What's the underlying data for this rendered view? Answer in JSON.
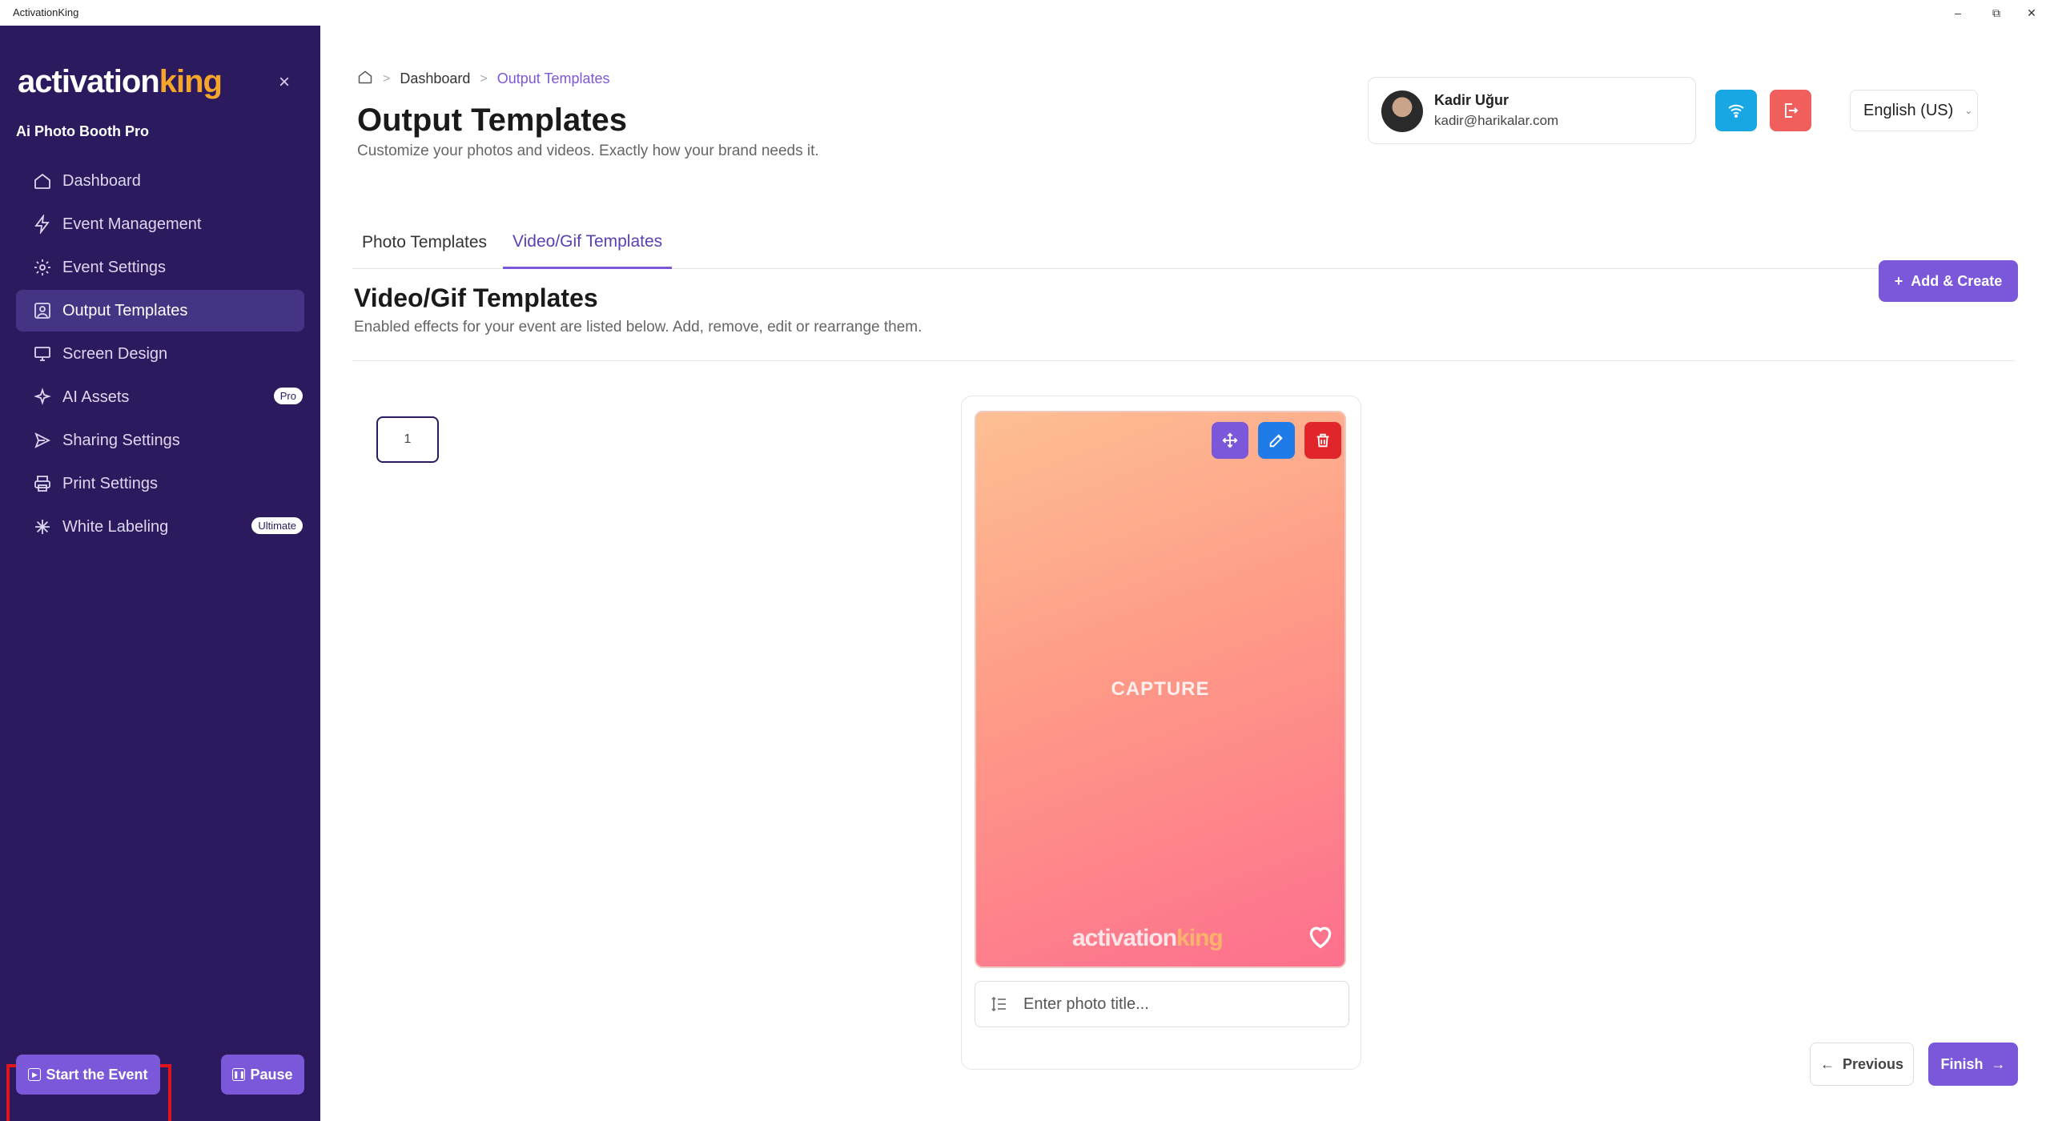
{
  "window": {
    "title": "ActivationKing",
    "minimize": "–",
    "restore": "⧉",
    "close": "✕"
  },
  "sidebar": {
    "logo_activation": "activation",
    "logo_king": "king",
    "close_glyph": "×",
    "product_name": "Ai Photo Booth Pro",
    "items": [
      {
        "label": "Dashboard",
        "icon": "home-icon"
      },
      {
        "label": "Event Management",
        "icon": "bolt-icon"
      },
      {
        "label": "Event Settings",
        "icon": "gear-icon"
      },
      {
        "label": "Output Templates",
        "icon": "portrait-icon",
        "active": true
      },
      {
        "label": "Screen Design",
        "icon": "monitor-icon"
      },
      {
        "label": "AI Assets",
        "icon": "sparkle-icon",
        "badge": "Pro"
      },
      {
        "label": "Sharing Settings",
        "icon": "share-icon"
      },
      {
        "label": "Print Settings",
        "icon": "printer-icon"
      },
      {
        "label": "White Labeling",
        "icon": "asterisk-icon",
        "badge": "Ultimate"
      }
    ],
    "start_label": "Start the Event",
    "pause_label": "Pause"
  },
  "breadcrumb": {
    "items": [
      "Dashboard",
      "Output Templates"
    ],
    "separator": ">"
  },
  "header": {
    "title": "Output Templates",
    "subtitle": "Customize your photos and videos. Exactly how your brand needs it."
  },
  "user": {
    "name": "Kadir Uğur",
    "email": "kadir@harikalar.com"
  },
  "language": {
    "selected": "English (US)"
  },
  "tabs": [
    {
      "label": "Photo Templates",
      "active": false
    },
    {
      "label": "Video/Gif Templates",
      "active": true
    }
  ],
  "section": {
    "title": "Video/Gif Templates",
    "subtitle": "Enabled effects for your event are listed below. Add, remove, edit or rearrange them.",
    "add_label": "Add & Create"
  },
  "template": {
    "index": "1",
    "preview_label": "CAPTURE",
    "logo_activation": "activation",
    "logo_king": "king",
    "title_placeholder": "Enter photo title..."
  },
  "footer": {
    "previous_label": "Previous",
    "finish_label": "Finish"
  },
  "colors": {
    "sidebar": "#2b1a5e",
    "accent": "#7b58d9",
    "wifi": "#18a7e3",
    "logout": "#f05f5c",
    "delete": "#e0262a",
    "edit": "#1e7be8"
  }
}
